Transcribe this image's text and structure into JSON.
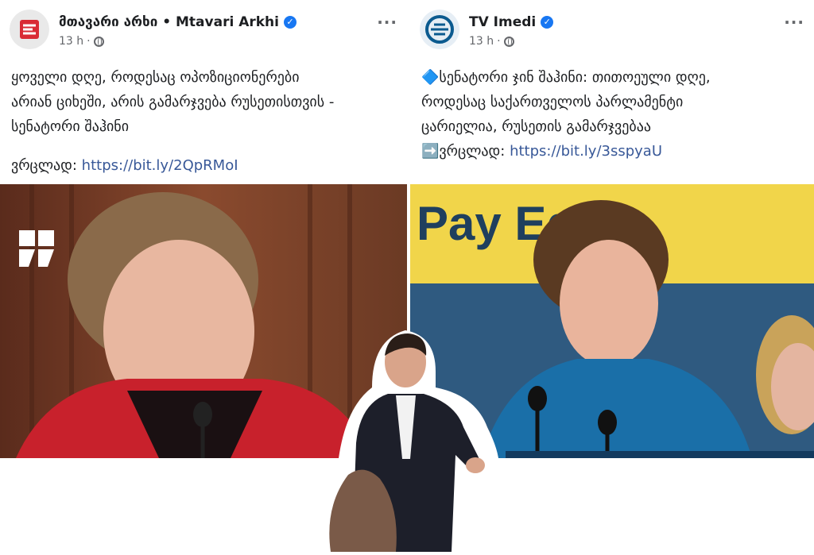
{
  "posts": [
    {
      "page_name": "მთავარი არხი • Mtavari Arkhi",
      "time": "13 h",
      "text_lines": [
        "ყოველი დღე, როდესაც ოპოზიციონერები",
        "არიან ციხეში, არის გამარჯვება რუსეთისთვის -",
        "სენატორი შაჰინი"
      ],
      "link_prefix": "ვრცლად:",
      "link": "https://bit.ly/2QpRMoI",
      "avatar_icon": "mtavari-logo-icon"
    },
    {
      "page_name": "TV Imedi",
      "time": "13 h",
      "text_lines": [
        "🔷სენატორი ჯინ შაჰინი: თითოეული დღე,",
        "როდესაც საქართველოს პარლამენტი",
        "ცარიელია, რუსეთის გამარჯვებაა"
      ],
      "link_prefix": "➡️ვრცლად:",
      "link": "https://bit.ly/3sspyaU",
      "avatar_icon": "imedi-logo-icon"
    }
  ],
  "photo_right_sign_text": "Pay Equa",
  "colors": {
    "link": "#385898",
    "verified": "#1877f2",
    "meta": "#65676b"
  }
}
